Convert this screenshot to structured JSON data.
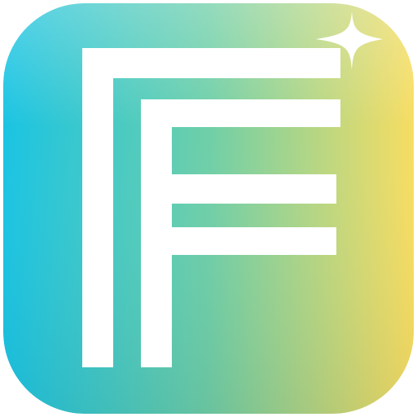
{
  "icon": {
    "name": "app-launcher-icon",
    "glyph": "F-logo",
    "accent_icon": "sparkle-icon",
    "colors": {
      "gradient_start": "#1ac4e3",
      "gradient_mid": "#6fcfa8",
      "gradient_end": "#f7dd62",
      "glyph": "#ffffff",
      "sparkle": "#ffffff"
    }
  }
}
